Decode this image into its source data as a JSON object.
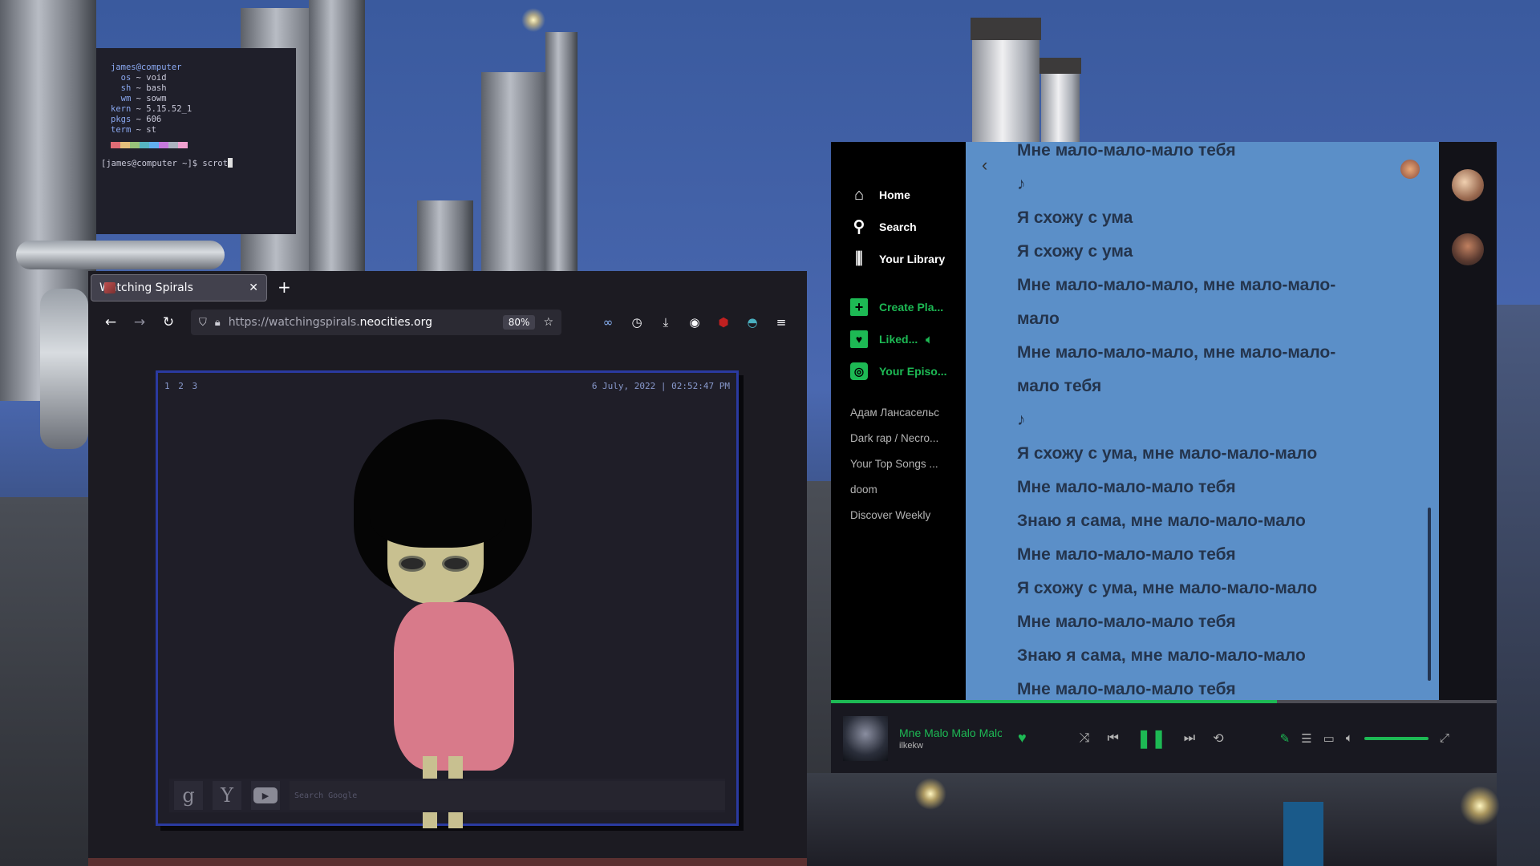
{
  "terminal": {
    "lines": [
      {
        "key": "james@computer",
        "val": ""
      },
      {
        "key": "  os",
        "val": " ~ void"
      },
      {
        "key": "  sh",
        "val": " ~ bash"
      },
      {
        "key": "  wm",
        "val": " ~ sowm"
      },
      {
        "key": "kern",
        "val": " ~ 5.15.52_1"
      },
      {
        "key": "pkgs",
        "val": " ~ 606"
      },
      {
        "key": "term",
        "val": " ~ st"
      }
    ],
    "palette": [
      "#e06c75",
      "#e5c07b",
      "#98c379",
      "#56b6c2",
      "#61afef",
      "#c678dd",
      "#abb2bf",
      "#f0a0d0"
    ],
    "prompt": "[james@computer ~]$ scrot"
  },
  "browser": {
    "tab_title": "Watching Spirals",
    "tab_close": "✕",
    "new_tab": "+",
    "url_prefix": "https://watchingspirals.",
    "url_domain": "neocities.org",
    "zoom": "80%",
    "page": {
      "page_numbers": "1 2 3",
      "datetime": "6 July, 2022 | 02:52:47 PM",
      "search_g": "g",
      "search_y": "Y",
      "search_placeholder": "Search Google"
    }
  },
  "spotify": {
    "nav": [
      {
        "icon": "home-icon",
        "label": "Home"
      },
      {
        "icon": "search-icon",
        "label": "Search"
      },
      {
        "icon": "library-icon",
        "label": "Your Library"
      }
    ],
    "create": "Create Pla...",
    "liked": "Liked...",
    "episodes": "Your Episo...",
    "playlists": [
      "Адам Лансасельс",
      "Dark rap / Necro...",
      "Your Top Songs ...",
      "doom",
      "Discover Weekly"
    ],
    "lyrics": [
      "Мне мало-мало-мало тебя",
      "♪",
      "Я схожу с ума",
      "Я схожу с ума",
      "Мне мало-мало-мало, мне мало-мало-",
      "мало",
      "Мне мало-мало-мало, мне мало-мало-",
      "мало тебя",
      "♪",
      "Я схожу с ума, мне мало-мало-мало",
      "Мне мало-мало-мало тебя",
      "Знаю я сама, мне мало-мало-мало",
      "Мне мало-мало-мало тебя",
      "Я схожу с ума, мне мало-мало-мало",
      "Мне мало-мало-мало тебя",
      "Знаю я сама, мне мало-мало-мало",
      "Мне мало-мало-мало тебя"
    ],
    "track": {
      "name": "Mne Malo Malo Malo",
      "artist": "ilkekw",
      "progress": 0.67
    },
    "colors": {
      "accent": "#1db954",
      "lyrics_bg": "#5b8fc8"
    }
  }
}
